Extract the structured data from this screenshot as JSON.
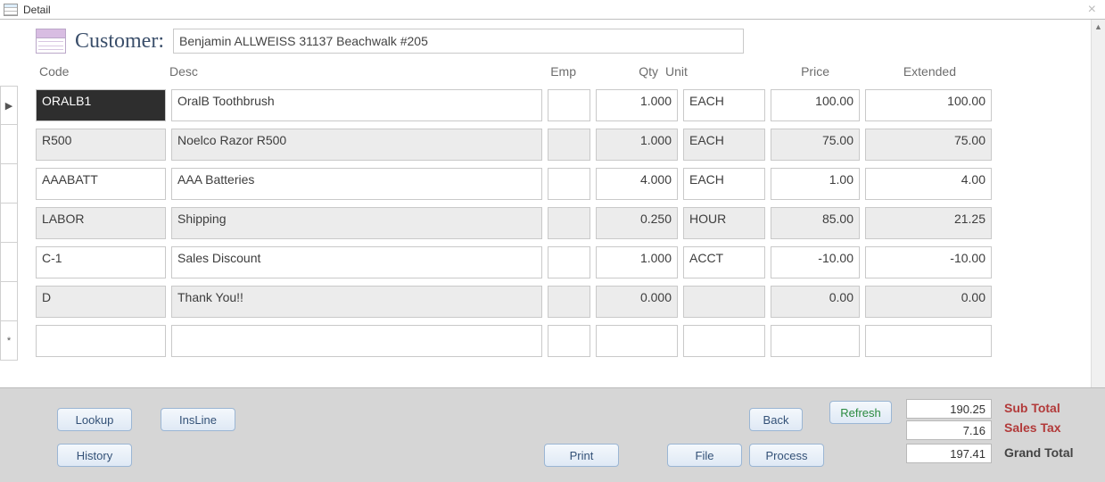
{
  "window": {
    "title": "Detail"
  },
  "header": {
    "label": "Customer:",
    "customer_value": "Benjamin ALLWEISS 31137 Beachwalk #205"
  },
  "columns": {
    "code": "Code",
    "desc": "Desc",
    "emp": "Emp",
    "qty": "Qty",
    "unit": "Unit",
    "price": "Price",
    "extended": "Extended"
  },
  "rows": [
    {
      "code": "ORALB1",
      "desc": "OralB Toothbrush",
      "emp": "",
      "qty": "1.000",
      "unit": "EACH",
      "price": "100.00",
      "ext": "100.00",
      "selected": true
    },
    {
      "code": "R500",
      "desc": "Noelco Razor R500",
      "emp": "",
      "qty": "1.000",
      "unit": "EACH",
      "price": "75.00",
      "ext": "75.00"
    },
    {
      "code": "AAABATT",
      "desc": "AAA Batteries",
      "emp": "",
      "qty": "4.000",
      "unit": "EACH",
      "price": "1.00",
      "ext": "4.00"
    },
    {
      "code": "LABOR",
      "desc": "Shipping",
      "emp": "",
      "qty": "0.250",
      "unit": "HOUR",
      "price": "85.00",
      "ext": "21.25"
    },
    {
      "code": "C-1",
      "desc": "Sales Discount",
      "emp": "",
      "qty": "1.000",
      "unit": "ACCT",
      "price": "-10.00",
      "ext": "-10.00"
    },
    {
      "code": "D",
      "desc": "Thank You!!",
      "emp": "",
      "qty": "0.000",
      "unit": "",
      "price": "0.00",
      "ext": "0.00"
    },
    {
      "code": "",
      "desc": "",
      "emp": "",
      "qty": "",
      "unit": "",
      "price": "",
      "ext": "",
      "new": true
    }
  ],
  "buttons": {
    "lookup": "Lookup",
    "insline": "InsLine",
    "history": "History",
    "print": "Print",
    "file": "File",
    "back": "Back",
    "refresh": "Refresh",
    "process": "Process"
  },
  "totals": {
    "subtotal_label": "Sub Total",
    "subtotal_value": "190.25",
    "salestax_label": "Sales Tax",
    "salestax_value": "7.16",
    "grandtotal_label": "Grand Total",
    "grandtotal_value": "197.41"
  }
}
